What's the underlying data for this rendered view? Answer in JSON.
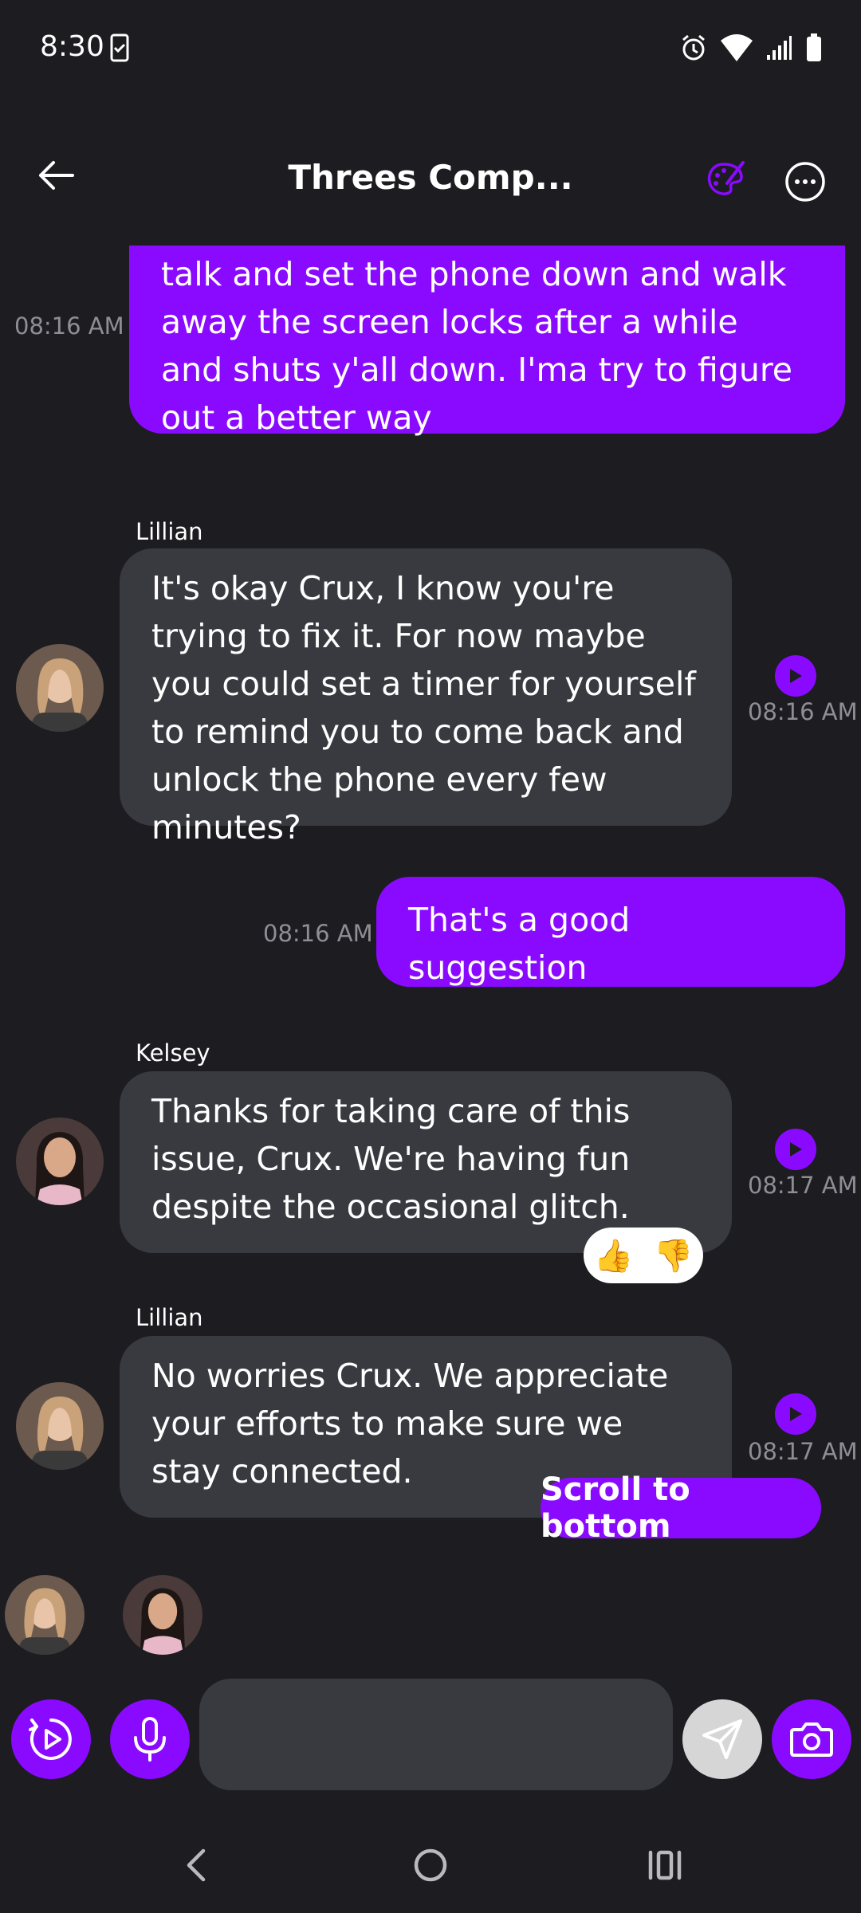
{
  "status_bar": {
    "time": "8:30"
  },
  "header": {
    "title": "Threes Comp..."
  },
  "messages": [
    {
      "type": "outgoing",
      "text": "talk and set the phone down and walk away the screen locks after a while and shuts y'all down. I'ma try to figure out a better way",
      "time": "08:16 AM"
    },
    {
      "type": "incoming",
      "sender": "Lillian",
      "text": "It's okay Crux, I know you're trying to fix it. For now maybe you could set a timer for yourself to remind you to come back and unlock the phone every few minutes?",
      "time": "08:16 AM"
    },
    {
      "type": "outgoing",
      "text": "That's a good suggestion",
      "time": "08:16 AM"
    },
    {
      "type": "incoming",
      "sender": "Kelsey",
      "text": "Thanks for taking care of this issue, Crux. We're having fun despite the occasional glitch.",
      "time": "08:17 AM",
      "reactions": [
        "👍",
        "👎"
      ]
    },
    {
      "type": "incoming",
      "sender": "Lillian",
      "text": "No worries Crux. We appreciate your efforts to make sure we stay connected.",
      "time": "08:17 AM"
    }
  ],
  "scroll_button": {
    "label": "Scroll to bottom"
  },
  "composer": {
    "placeholder": ""
  },
  "colors": {
    "accent": "#8a0aff",
    "background": "#1c1c21",
    "incoming_bubble": "#393a40",
    "timestamp": "#8e8e95"
  }
}
